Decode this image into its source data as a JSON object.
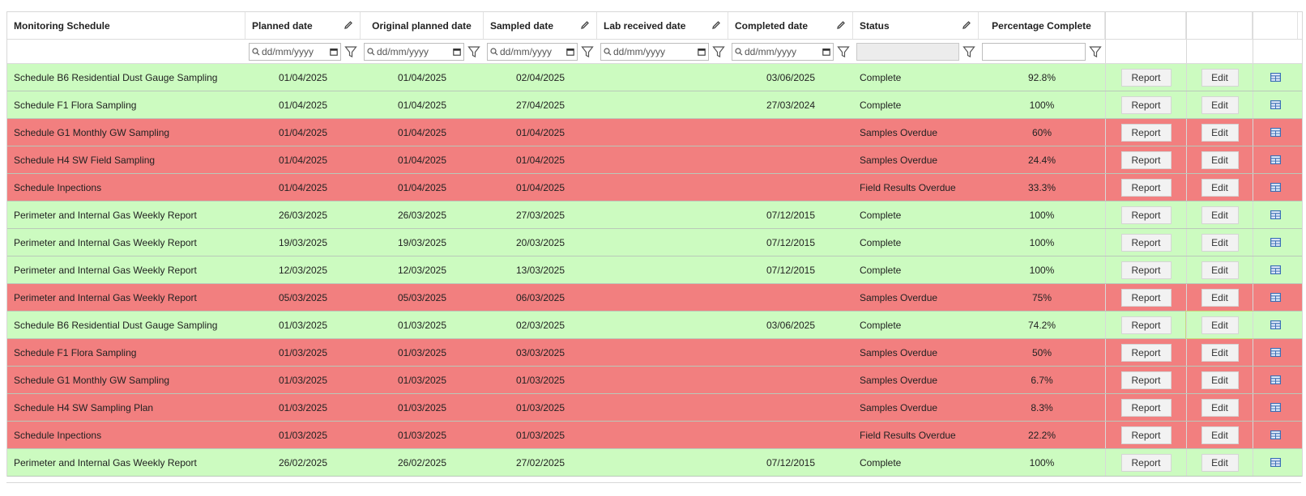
{
  "columns": {
    "schedule": "Monitoring Schedule",
    "planned": "Planned date",
    "original": "Original planned date",
    "sampled": "Sampled date",
    "lab": "Lab received date",
    "completed": "Completed date",
    "status": "Status",
    "percent": "Percentage Complete"
  },
  "filters": {
    "planned_placeholder": "dd/mm/yyyy",
    "original_placeholder": "dd/mm/yyyy",
    "sampled_placeholder": "dd/mm/yyyy",
    "lab_placeholder": "dd/mm/yyyy",
    "completed_placeholder": "dd/mm/yyyy"
  },
  "buttons": {
    "report": "Report",
    "edit": "Edit"
  },
  "colors": {
    "complete": "#ccfbc0",
    "overdue": "#f27f7f",
    "view_icon": "#3b6fb6"
  },
  "rows": [
    {
      "schedule": "Schedule B6 Residential Dust Gauge Sampling",
      "planned": "01/04/2025",
      "original": "01/04/2025",
      "sampled": "02/04/2025",
      "lab": "",
      "completed": "03/06/2025",
      "status": "Complete",
      "percent": "92.8%",
      "state": "complete"
    },
    {
      "schedule": "Schedule F1 Flora Sampling",
      "planned": "01/04/2025",
      "original": "01/04/2025",
      "sampled": "27/04/2025",
      "lab": "",
      "completed": "27/03/2024",
      "status": "Complete",
      "percent": "100%",
      "state": "complete"
    },
    {
      "schedule": "Schedule G1 Monthly GW Sampling",
      "planned": "01/04/2025",
      "original": "01/04/2025",
      "sampled": "01/04/2025",
      "lab": "",
      "completed": "",
      "status": "Samples Overdue",
      "percent": "60%",
      "state": "overdue"
    },
    {
      "schedule": "Schedule H4 SW Field Sampling",
      "planned": "01/04/2025",
      "original": "01/04/2025",
      "sampled": "01/04/2025",
      "lab": "",
      "completed": "",
      "status": "Samples Overdue",
      "percent": "24.4%",
      "state": "overdue"
    },
    {
      "schedule": "Schedule Inpections",
      "planned": "01/04/2025",
      "original": "01/04/2025",
      "sampled": "01/04/2025",
      "lab": "",
      "completed": "",
      "status": "Field Results Overdue",
      "percent": "33.3%",
      "state": "overdue"
    },
    {
      "schedule": "Perimeter and Internal Gas Weekly Report",
      "planned": "26/03/2025",
      "original": "26/03/2025",
      "sampled": "27/03/2025",
      "lab": "",
      "completed": "07/12/2015",
      "status": "Complete",
      "percent": "100%",
      "state": "complete"
    },
    {
      "schedule": "Perimeter and Internal Gas Weekly Report",
      "planned": "19/03/2025",
      "original": "19/03/2025",
      "sampled": "20/03/2025",
      "lab": "",
      "completed": "07/12/2015",
      "status": "Complete",
      "percent": "100%",
      "state": "complete"
    },
    {
      "schedule": "Perimeter and Internal Gas Weekly Report",
      "planned": "12/03/2025",
      "original": "12/03/2025",
      "sampled": "13/03/2025",
      "lab": "",
      "completed": "07/12/2015",
      "status": "Complete",
      "percent": "100%",
      "state": "complete"
    },
    {
      "schedule": "Perimeter and Internal Gas Weekly Report",
      "planned": "05/03/2025",
      "original": "05/03/2025",
      "sampled": "06/03/2025",
      "lab": "",
      "completed": "",
      "status": "Samples Overdue",
      "percent": "75%",
      "state": "overdue"
    },
    {
      "schedule": "Schedule B6 Residential Dust Gauge Sampling",
      "planned": "01/03/2025",
      "original": "01/03/2025",
      "sampled": "02/03/2025",
      "lab": "",
      "completed": "03/06/2025",
      "status": "Complete",
      "percent": "74.2%",
      "state": "complete"
    },
    {
      "schedule": "Schedule F1 Flora Sampling",
      "planned": "01/03/2025",
      "original": "01/03/2025",
      "sampled": "03/03/2025",
      "lab": "",
      "completed": "",
      "status": "Samples Overdue",
      "percent": "50%",
      "state": "overdue"
    },
    {
      "schedule": "Schedule G1 Monthly GW Sampling",
      "planned": "01/03/2025",
      "original": "01/03/2025",
      "sampled": "01/03/2025",
      "lab": "",
      "completed": "",
      "status": "Samples Overdue",
      "percent": "6.7%",
      "state": "overdue"
    },
    {
      "schedule": "Schedule H4 SW Sampling Plan",
      "planned": "01/03/2025",
      "original": "01/03/2025",
      "sampled": "01/03/2025",
      "lab": "",
      "completed": "",
      "status": "Samples Overdue",
      "percent": "8.3%",
      "state": "overdue"
    },
    {
      "schedule": "Schedule Inpections",
      "planned": "01/03/2025",
      "original": "01/03/2025",
      "sampled": "01/03/2025",
      "lab": "",
      "completed": "",
      "status": "Field Results Overdue",
      "percent": "22.2%",
      "state": "overdue"
    },
    {
      "schedule": "Perimeter and Internal Gas Weekly Report",
      "planned": "26/02/2025",
      "original": "26/02/2025",
      "sampled": "27/02/2025",
      "lab": "",
      "completed": "07/12/2015",
      "status": "Complete",
      "percent": "100%",
      "state": "complete"
    }
  ]
}
